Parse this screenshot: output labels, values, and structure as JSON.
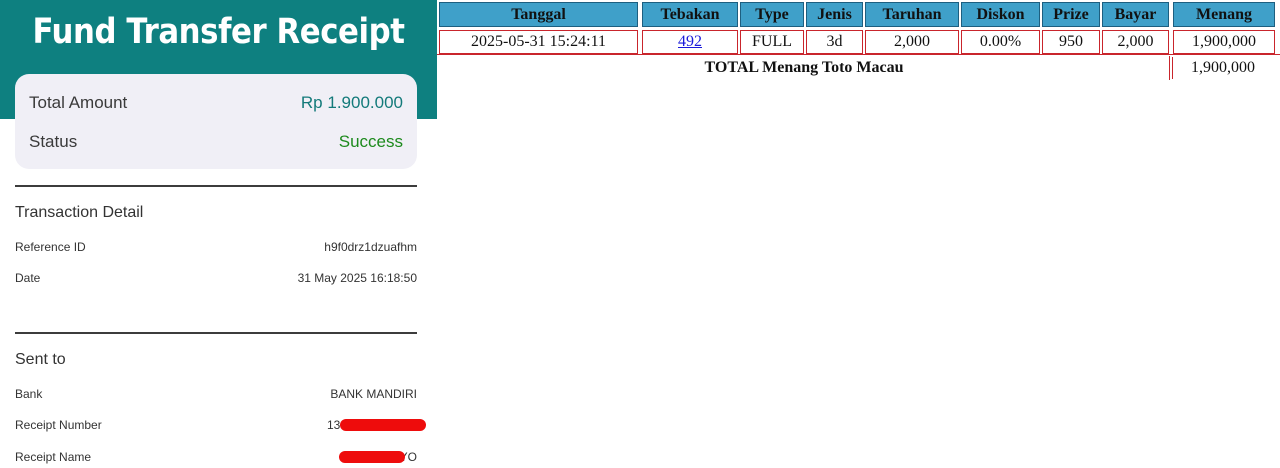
{
  "receipt": {
    "title": "Fund Transfer Receipt",
    "summary": {
      "total_amount_label": "Total Amount",
      "total_amount_value": "Rp 1.900.000",
      "status_label": "Status",
      "status_value": "Success"
    },
    "transaction_detail": {
      "title": "Transaction Detail",
      "reference_id_label": "Reference ID",
      "reference_id_value": "h9f0drz1dzuafhm",
      "date_label": "Date",
      "date_value": "31 May 2025 16:18:50"
    },
    "sent_to": {
      "title": "Sent to",
      "bank_label": "Bank",
      "bank_value": "BANK MANDIRI",
      "receipt_number_label": "Receipt Number",
      "receipt_number_value": "136",
      "receipt_name_label": "Receipt Name",
      "receipt_name_value": "YO"
    },
    "colors": {
      "header": "#0e8080",
      "amount": "#137a7a",
      "success": "#1d8a1d",
      "redaction": "#ee0c0c"
    }
  },
  "bet_table": {
    "headers": [
      "Tanggal",
      "Tebakan",
      "Type",
      "Jenis",
      "Taruhan",
      "Diskon",
      "Prize",
      "Bayar",
      "Menang"
    ],
    "row": {
      "tanggal": "2025-05-31 15:24:11",
      "tebakan": "492",
      "type": "FULL",
      "jenis": "3d",
      "taruhan": "2,000",
      "diskon": "0.00%",
      "prize": "950",
      "bayar": "2,000",
      "menang": "1,900,000"
    },
    "total_label": "TOTAL  Menang Toto Macau",
    "total_value": "1,900,000",
    "colors": {
      "header_bg": "#3fa0c9",
      "border": "#c9252c",
      "link": "#1a1adb"
    }
  }
}
